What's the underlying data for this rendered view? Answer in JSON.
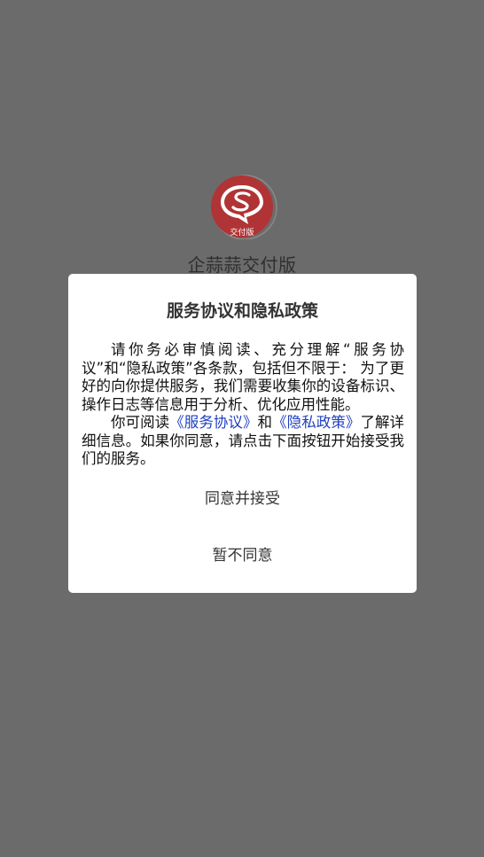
{
  "app": {
    "name": "企蒜蒜交付版",
    "logo_badge": "交付版",
    "logo_icon": "speech-bubble-s-icon",
    "brand_color": "#c0393b"
  },
  "dialog": {
    "title": "服务协议和隐私政策",
    "paragraph1": "请你务必审慎阅读、充分理解“服务协议”和“隐私政策”各条款，包括但不限于： 为了更好的向你提供服务，我们需要收集你的设备标识、操作日志等信息用于分析、优化应用性能。",
    "paragraph2_prefix": "你可阅读",
    "service_agreement_link": "《服务协议》",
    "and_text": "和",
    "privacy_policy_link": "《隐私政策》",
    "paragraph2_suffix": "了解详细信息。如果你同意，请点击下面按钮开始接受我们的服务。",
    "agree_button": "同意并接受",
    "disagree_button": "暂不同意",
    "link_color": "#1f3fbf"
  }
}
